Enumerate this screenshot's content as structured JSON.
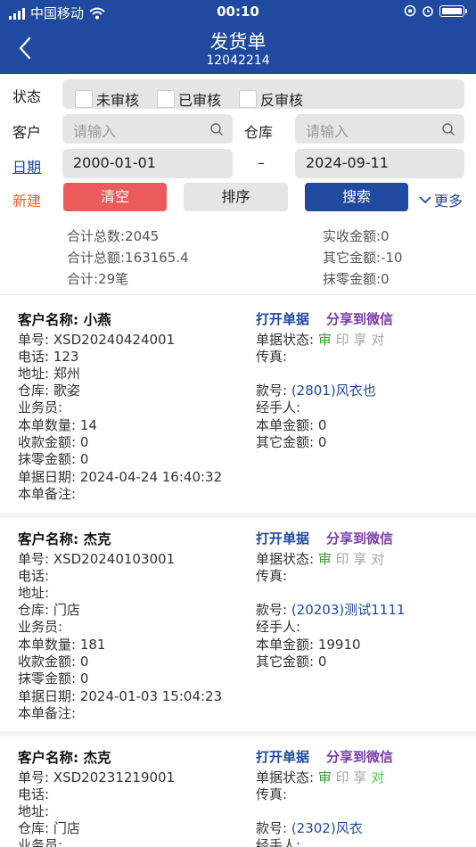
{
  "status_bar": {
    "carrier": "中国移动",
    "time": "00:10"
  },
  "header": {
    "title": "发货单",
    "subtitle": "12042214"
  },
  "filters": {
    "status_label": "状态",
    "status_options": [
      "未审核",
      "已审核",
      "反审核"
    ],
    "customer_label": "客户",
    "customer_placeholder": "请输入",
    "warehouse_label": "仓库",
    "warehouse_placeholder": "请输入",
    "date_label": "日期",
    "date_from": "2000-01-01",
    "date_sep": "–",
    "date_to": "2024-09-11",
    "new_label": "新建",
    "clear_label": "清空",
    "sort_label": "排序",
    "search_label": "搜索",
    "more_label": "更多"
  },
  "summary": {
    "total_count": "合计总数:2045",
    "total_amount": "合计总额:163165.4",
    "total_orders": "合计:29笔",
    "received": "实收金额:0",
    "other": "其它金额:-10",
    "rounding": "抹零金额:0"
  },
  "card_labels": {
    "open": "打开单据",
    "share": "分享到微信",
    "status_prefix": "单据状态: ",
    "status_marks": [
      "审",
      "印",
      "享",
      "对"
    ]
  },
  "orders": [
    {
      "customer": "客户名称: 小燕",
      "no": "单号: XSD20240424001",
      "phone": "电话: 123",
      "address": "地址: 郑州",
      "warehouse": "仓库: 歌姿",
      "salesman": "业务员:",
      "qty": "本单数量: 14",
      "received": "收款金额: 0",
      "rounding": "抹零金额: 0",
      "date": "单据日期: 2024-04-24 16:40:32",
      "note": "本单备注:",
      "fax": "传真:",
      "item_prefix": "款号: ",
      "item": "(2801)风衣也",
      "handler": "经手人:",
      "amount": "本单金额: 0",
      "other": "其它金额: 0",
      "marks_state": [
        "on",
        "off",
        "off",
        "off"
      ]
    },
    {
      "customer": "客户名称: 杰克",
      "no": "单号: XSD20240103001",
      "phone": "电话:",
      "address": "地址:",
      "warehouse": "仓库: 门店",
      "salesman": "业务员:",
      "qty": "本单数量: 181",
      "received": "收款金额: 0",
      "rounding": "抹零金额: 0",
      "date": "单据日期: 2024-01-03 15:04:23",
      "note": "本单备注:",
      "fax": "传真:",
      "item_prefix": "款号: ",
      "item": "(20203)测试1111",
      "handler": "经手人:",
      "amount": "本单金额: 19910",
      "other": "其它金额: 0",
      "marks_state": [
        "on",
        "off",
        "off",
        "off"
      ]
    },
    {
      "customer": "客户名称: 杰克",
      "no": "单号: XSD20231219001",
      "phone": "电话:",
      "address": "地址:",
      "warehouse": "仓库: 门店",
      "salesman": "业务员:",
      "fax": "传真:",
      "item_prefix": "款号: ",
      "item": "(2302)风衣",
      "handler": "经手人:",
      "marks_state": [
        "on",
        "off",
        "off",
        "bright"
      ]
    }
  ],
  "colors": {
    "header_bg": "#1f4aa0",
    "clear_button": "#ec5b5b",
    "search_button": "#1f4aa0",
    "new_label": "#e8642b",
    "approved_mark": "#3aa02f",
    "share_link": "#7a3ea8"
  }
}
